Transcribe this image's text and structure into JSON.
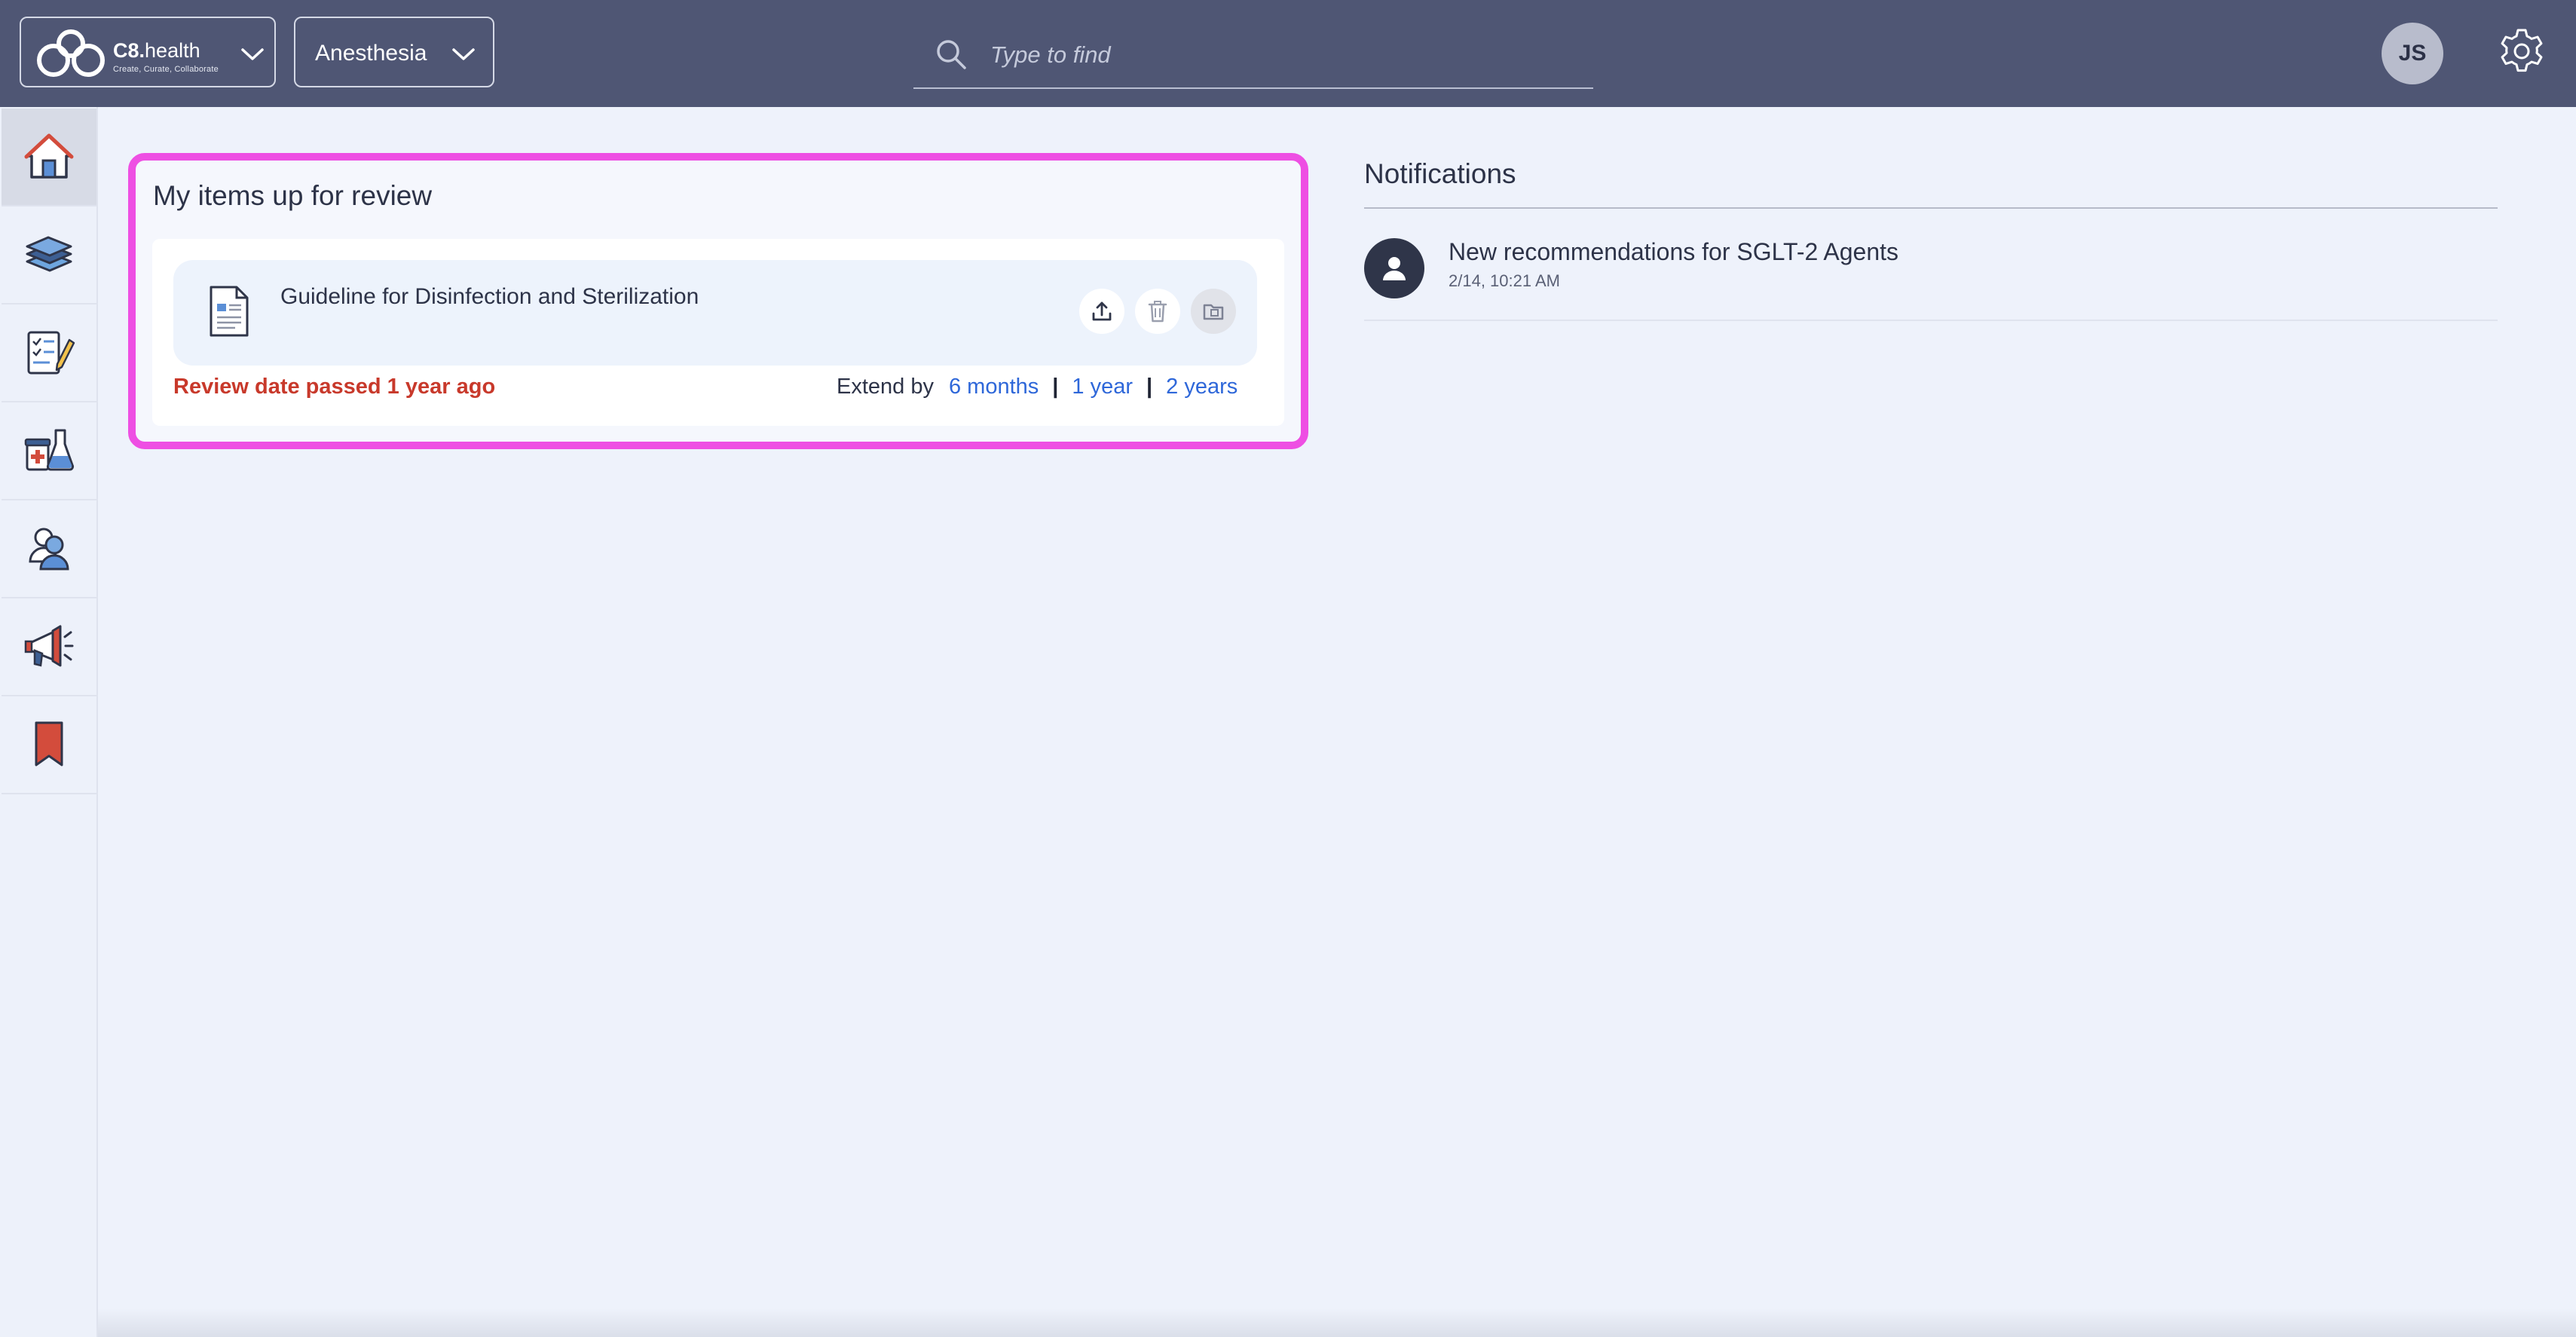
{
  "header": {
    "brand": {
      "name_bold": "C8.",
      "name_rest": "health",
      "tagline": "Create, Curate, Collaborate"
    },
    "department": "Anesthesia",
    "search": {
      "placeholder": "Type to find",
      "value": ""
    },
    "user_initials": "JS"
  },
  "sidebar": {
    "items": [
      {
        "id": "home",
        "icon": "home-icon",
        "active": true
      },
      {
        "id": "library",
        "icon": "books-icon",
        "active": false
      },
      {
        "id": "checklists",
        "icon": "checklist-icon",
        "active": false
      },
      {
        "id": "medications",
        "icon": "lab-medical-icon",
        "active": false
      },
      {
        "id": "people",
        "icon": "people-icon",
        "active": false
      },
      {
        "id": "announcements",
        "icon": "megaphone-icon",
        "active": false
      },
      {
        "id": "bookmarks",
        "icon": "bookmark-icon",
        "active": false
      }
    ]
  },
  "review": {
    "title": "My items up for review",
    "items": [
      {
        "title": "Guideline for Disinfection and Sterilization",
        "status": "Review date passed 1 year ago",
        "extend_label": "Extend by",
        "extend_options": [
          "6 months",
          "1 year",
          "2 years"
        ],
        "separator": "|"
      }
    ]
  },
  "notifications": {
    "title": "Notifications",
    "items": [
      {
        "text": "New recommendations for SGLT-2 Agents",
        "time": "2/14, 10:21 AM"
      }
    ]
  },
  "colors": {
    "topbar": "#4f5674",
    "background": "#eef2fb",
    "highlight_border": "#ee4fe3",
    "overdue": "#c8392b",
    "link": "#2e67d9"
  }
}
